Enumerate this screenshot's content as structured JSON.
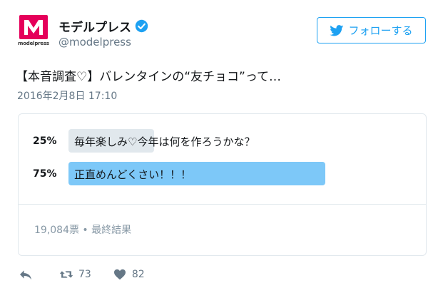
{
  "profile": {
    "display_name": "モデルプレス",
    "handle": "@modelpress",
    "avatar_brand": "modelpress",
    "avatar_icon": "modelpress-logo",
    "verified_icon": "verified-badge-icon"
  },
  "follow_button": {
    "label": "フォローする",
    "icon": "twitter-bird-icon"
  },
  "tweet": {
    "text": "【本音調査♡】バレンタインの“友チョコ”って…",
    "timestamp": "2016年2月8日 17:10"
  },
  "poll": {
    "options": [
      {
        "percent_label": "25%",
        "percent": 25,
        "text": "毎年楽しみ♡今年は何を作ろうかな？"
      },
      {
        "percent_label": "75%",
        "percent": 75,
        "text": "正直めんどくさい！！！"
      }
    ],
    "meta": "19,084票 • 最終結果"
  },
  "actions": {
    "reply_icon": "reply-icon",
    "retweet_icon": "retweet-icon",
    "retweet_count": "73",
    "like_icon": "heart-icon",
    "like_count": "82"
  },
  "colors": {
    "twitter_blue": "#1da1f2",
    "poll_winner": "#7dc8f8",
    "poll_other": "#e1e8ed",
    "brand_pink": "#e5005a"
  }
}
